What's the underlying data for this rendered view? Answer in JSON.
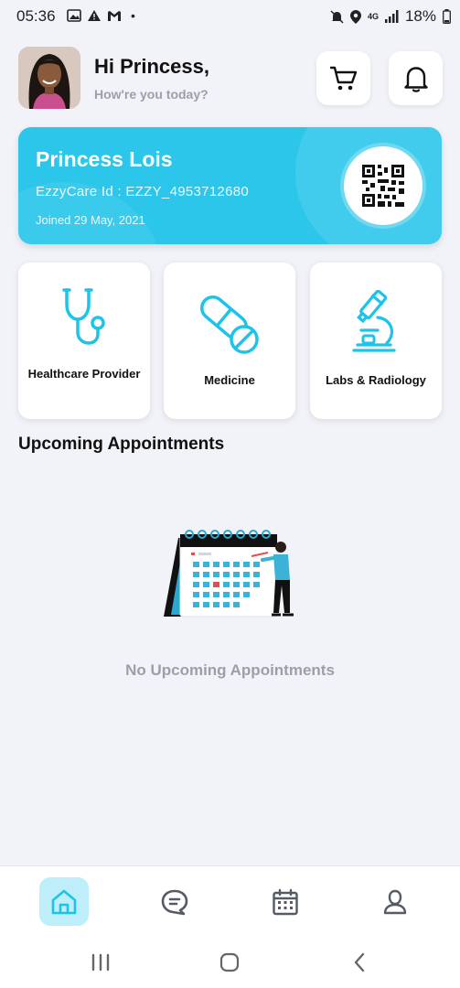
{
  "status_bar": {
    "time": "05:36",
    "battery": "18%",
    "network": "4G"
  },
  "header": {
    "greeting": "Hi Princess,",
    "subtitle": "How're you today?"
  },
  "id_card": {
    "name": "Princess Lois",
    "id_text": "EzzyCare Id : EZZY_4953712680",
    "joined": "Joined 29 May, 2021"
  },
  "services": [
    {
      "label": "Healthcare Provider",
      "icon": "stethoscope-icon"
    },
    {
      "label": "Medicine",
      "icon": "pill-icon"
    },
    {
      "label": "Labs & Radiology",
      "icon": "microscope-icon"
    }
  ],
  "appointments": {
    "title": "Upcoming Appointments",
    "empty_text": "No Upcoming Appointments"
  },
  "nav": {
    "items": [
      {
        "icon": "home-icon",
        "active": true
      },
      {
        "icon": "chat-icon",
        "active": false
      },
      {
        "icon": "calendar-icon",
        "active": false
      },
      {
        "icon": "profile-icon",
        "active": false
      }
    ]
  },
  "colors": {
    "accent": "#2cc6ea",
    "icon": "#1ec3e9",
    "nav_active_bg": "#bdeef9",
    "muted_text": "#9ba0a8"
  }
}
